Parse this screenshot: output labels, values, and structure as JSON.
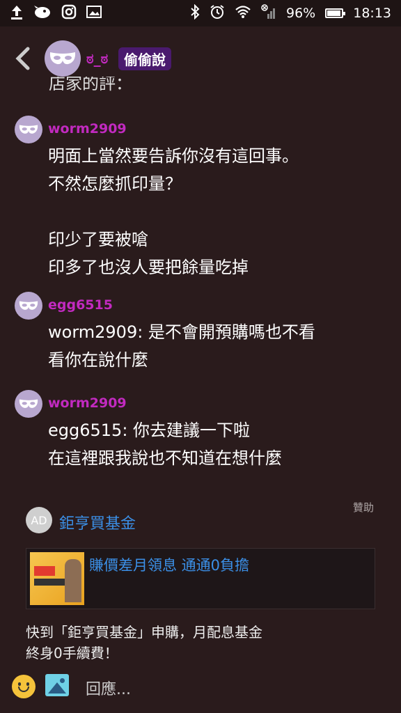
{
  "status_bar": {
    "battery": "96%",
    "battery_level": 0.96,
    "time": "18:13",
    "icons": [
      "upload-icon",
      "bird-icon",
      "instagram-icon",
      "image-icon",
      "bluetooth-icon",
      "alarm-icon",
      "wifi-icon",
      "no-signal-icon",
      "battery-icon"
    ]
  },
  "header": {
    "username": "ಠ_ಠ",
    "badge": "偷偷說"
  },
  "cutoff_text": "店家的評：",
  "messages": [
    {
      "username": "worm2909",
      "text": "明面上當然要告訴你沒有這回事。\n不然怎麼抓印量？\n\n印少了要被嗆\n印多了也沒人要把餘量吃掉"
    },
    {
      "username": "egg6515",
      "text": "worm2909: 是不會開預購嗎也不看\n看你在說什麼"
    },
    {
      "username": "worm2909",
      "text": "egg6515: 你去建議一下啦\n在這裡跟我說也不知道在想什麼"
    }
  ],
  "ad": {
    "sponsored_label": "贊助",
    "avatar_text": "AD",
    "advertiser": "鉅亨買基金",
    "headline": "賺價差月領息  通通0負擔",
    "description": "快到「鉅亨買基金」申購，月配息基金\n終身0手續費！"
  },
  "composer": {
    "placeholder": "回應..."
  },
  "colors": {
    "background": "#2a1b1c",
    "username": "#c22ac0",
    "link": "#3b8fe6",
    "avatar": "#b8a7cf"
  }
}
